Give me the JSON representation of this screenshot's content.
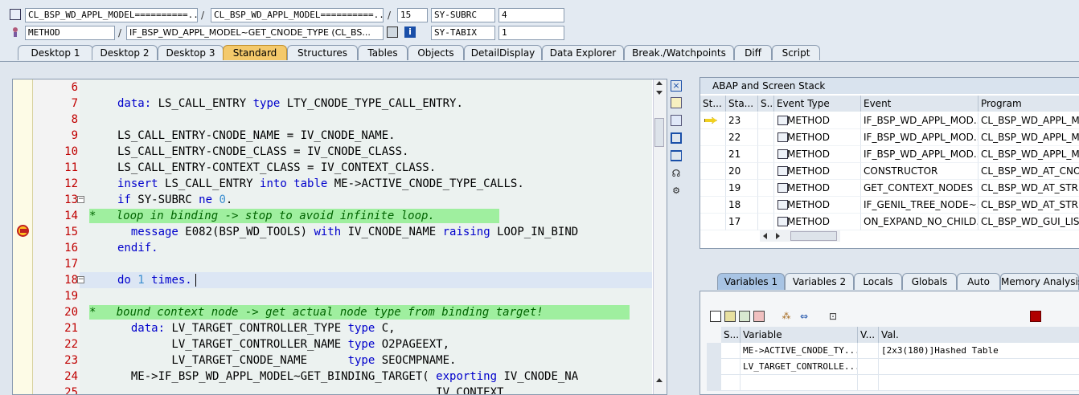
{
  "header": {
    "row1": {
      "field1": "CL_BSP_WD_APPL_MODEL==========...",
      "sep1": "/",
      "field2": "CL_BSP_WD_APPL_MODEL==========...",
      "sep2": "/",
      "field3": "15",
      "sysvar_name": "SY-SUBRC",
      "sysvar_value": "4"
    },
    "row2": {
      "field1": "METHOD",
      "sep1": "/",
      "field2": "IF_BSP_WD_APPL_MODEL~GET_CNODE_TYPE (CL_BS...",
      "sysvar_name": "SY-TABIX",
      "sysvar_value": "1"
    }
  },
  "tabs": [
    "Desktop 1",
    "Desktop 2",
    "Desktop 3",
    "Standard",
    "Structures",
    "Tables",
    "Objects",
    "DetailDisplay",
    "Data Explorer",
    "Break./Watchpoints",
    "Diff",
    "Script"
  ],
  "active_tab": "Standard",
  "editor": {
    "line_numbers": [
      "6",
      "7",
      "8",
      "9",
      "10",
      "11",
      "12",
      "13",
      "14",
      "15",
      "16",
      "17",
      "18",
      "19",
      "20",
      "21",
      "22",
      "23",
      "24",
      "25"
    ],
    "lines": [
      [],
      [
        {
          "t": "data: ",
          "k": "kw"
        },
        {
          "t": "LS_CALL_ENTRY "
        },
        {
          "t": "type ",
          "k": "kw"
        },
        {
          "t": "LTY_CNODE_TYPE_CALL_ENTRY."
        }
      ],
      [],
      [
        {
          "t": "LS_CALL_ENTRY-CNODE_NAME = IV_CNODE_NAME."
        }
      ],
      [
        {
          "t": "LS_CALL_ENTRY-CNODE_CLASS = IV_CNODE_CLASS."
        }
      ],
      [
        {
          "t": "LS_CALL_ENTRY-CONTEXT_CLASS = IV_CONTEXT_CLASS."
        }
      ],
      [
        {
          "t": "insert ",
          "k": "kw"
        },
        {
          "t": "LS_CALL_ENTRY "
        },
        {
          "t": "into table ",
          "k": "kw"
        },
        {
          "t": "ME->ACTIVE_CNODE_TYPE_CALLS."
        }
      ],
      [
        {
          "t": "if ",
          "k": "kw"
        },
        {
          "t": "SY-SUBRC "
        },
        {
          "t": "ne ",
          "k": "kw"
        },
        {
          "t": "0",
          "k": "num"
        },
        {
          "t": "."
        }
      ],
      [
        {
          "t": "*   loop in binding -> stop to avoid infinite loop.",
          "k": "cmt"
        }
      ],
      [
        {
          "t": "  message ",
          "k": "kw"
        },
        {
          "t": "E082(BSP_WD_TOOLS) "
        },
        {
          "t": "with ",
          "k": "kw"
        },
        {
          "t": "IV_CNODE_NAME "
        },
        {
          "t": "raising ",
          "k": "kw"
        },
        {
          "t": "LOOP_IN_BIND"
        }
      ],
      [
        {
          "t": "endif.",
          "k": "kw"
        }
      ],
      [],
      [
        {
          "t": "do ",
          "k": "kw"
        },
        {
          "t": "1 ",
          "k": "num"
        },
        {
          "t": "times.",
          "k": "kw"
        }
      ],
      [],
      [
        {
          "t": "*   bound context node -> get actual node type from binding target!",
          "k": "cmt"
        }
      ],
      [
        {
          "t": "  data: ",
          "k": "kw"
        },
        {
          "t": "LV_TARGET_CONTROLLER_TYPE "
        },
        {
          "t": "type ",
          "k": "kw"
        },
        {
          "t": "C,"
        }
      ],
      [
        {
          "t": "        LV_TARGET_CONTROLLER_NAME "
        },
        {
          "t": "type ",
          "k": "kw"
        },
        {
          "t": "O2PAGEEXT,"
        }
      ],
      [
        {
          "t": "        LV_TARGET_CNODE_NAME      "
        },
        {
          "t": "type ",
          "k": "kw"
        },
        {
          "t": "SEOCMPNAME."
        }
      ],
      [
        {
          "t": "  ME->IF_BSP_WD_APPL_MODEL~GET_BINDING_TARGET( "
        },
        {
          "t": "exporting ",
          "k": "kw"
        },
        {
          "t": "IV_CNODE_NA"
        }
      ],
      [
        {
          "t": "                                               IV_CONTEXT_"
        }
      ]
    ]
  },
  "stack": {
    "title": "ABAP and Screen Stack",
    "columns": [
      "St...",
      "Sta...",
      "S...",
      "Event Type",
      "Event",
      "Program"
    ],
    "rows": [
      {
        "level": "23",
        "type": "METHOD",
        "event": "IF_BSP_WD_APPL_MOD...",
        "program": "CL_BSP_WD_APPL_MO"
      },
      {
        "level": "22",
        "type": "METHOD",
        "event": "IF_BSP_WD_APPL_MOD...",
        "program": "CL_BSP_WD_APPL_MO"
      },
      {
        "level": "21",
        "type": "METHOD",
        "event": "IF_BSP_WD_APPL_MOD...",
        "program": "CL_BSP_WD_APPL_MO"
      },
      {
        "level": "20",
        "type": "METHOD",
        "event": "CONSTRUCTOR",
        "program": "CL_BSP_WD_AT_CNO"
      },
      {
        "level": "19",
        "type": "METHOD",
        "event": "GET_CONTEXT_NODES",
        "program": "CL_BSP_WD_AT_STRU"
      },
      {
        "level": "18",
        "type": "METHOD",
        "event": "IF_GENIL_TREE_NODE~...",
        "program": "CL_BSP_WD_AT_STRU"
      },
      {
        "level": "17",
        "type": "METHOD",
        "event": "ON_EXPAND_NO_CHILD...",
        "program": "CL_BSP_WD_GUI_LIST"
      }
    ]
  },
  "variables": {
    "tabs": [
      "Variables 1",
      "Variables 2",
      "Locals",
      "Globals",
      "Auto",
      "Memory Analysis"
    ],
    "active_tab": "Variables 1",
    "columns": [
      "S...",
      "Variable",
      "V...",
      "Val."
    ],
    "rows": [
      {
        "name": "ME->ACTIVE_CNODE_TY...",
        "value": "[2x3(180)]Hashed Table"
      },
      {
        "name": "LV_TARGET_CONTROLLE...",
        "value": ""
      }
    ]
  },
  "colors": {
    "active_tab": "#f4c96b",
    "comment_bg": "#9fef9f",
    "keyword": "#0000cc",
    "line_number": "#c00000",
    "current_line": "#dce6f4"
  }
}
